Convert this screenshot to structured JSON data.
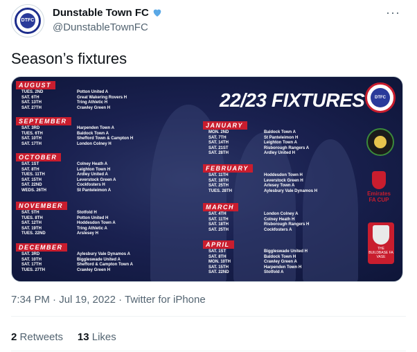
{
  "account": {
    "name": "Dunstable Town FC",
    "handle": "@DunstableTownFC",
    "avatar_text": "DTFC",
    "verified_icon": "heart-icon",
    "verified_color": "#5aa8e6"
  },
  "more_label": "···",
  "tweet": {
    "text": "Season’s fixtures",
    "timestamp": "7:34 PM · Jul 19, 2022 · Twitter for iPhone",
    "retweets": "2",
    "retweets_label": "Retweets",
    "likes": "13",
    "likes_label": "Likes"
  },
  "image": {
    "title": "22/23 FIXTURES",
    "crest_text": "DTFC",
    "facup_label": "Emirates FA CUP",
    "favase_label": "THE BUILDBASE FA VASE",
    "accent": "#c91d2e",
    "months": [
      {
        "name": "AUGUST",
        "fixtures": [
          {
            "date": "TUES. 2ND",
            "opp": "Potton United A"
          },
          {
            "date": "SAT. 6TH",
            "opp": "Great Wakering Rovers H"
          },
          {
            "date": "SAT. 13TH",
            "opp": "Tring Athletic H"
          },
          {
            "date": "SAT. 27TH",
            "opp": "Crawley Green H"
          }
        ]
      },
      {
        "name": "SEPTEMBER",
        "fixtures": [
          {
            "date": "SAT. 3RD",
            "opp": "Harpenden Town A"
          },
          {
            "date": "TUES. 6TH",
            "opp": "Baldock Town A"
          },
          {
            "date": "SAT. 10TH",
            "opp": "Shefford Town & Campton H"
          },
          {
            "date": "SAT. 17TH",
            "opp": "London Colney H"
          }
        ]
      },
      {
        "name": "OCTOBER",
        "fixtures": [
          {
            "date": "SAT. 1ST",
            "opp": "Colney Heath A"
          },
          {
            "date": "SAT. 8TH",
            "opp": "Leighton Town H"
          },
          {
            "date": "TUES. 11TH",
            "opp": "Ardley United A"
          },
          {
            "date": "SAT. 15TH",
            "opp": "Leverstock Green A"
          },
          {
            "date": "SAT. 22ND",
            "opp": "Cockfosters H"
          },
          {
            "date": "WEDS. 26TH",
            "opp": "St Panteleimon A"
          }
        ]
      },
      {
        "name": "NOVEMBER",
        "fixtures": [
          {
            "date": "SAT. 5TH",
            "opp": "Stotfold H"
          },
          {
            "date": "TUES. 8TH",
            "opp": "Potton United H"
          },
          {
            "date": "SAT. 12TH",
            "opp": "Hoddesdon Town A"
          },
          {
            "date": "SAT. 19TH",
            "opp": "Tring Athletic A"
          },
          {
            "date": "TUES. 22ND",
            "opp": "Arslesey H"
          }
        ]
      },
      {
        "name": "DECEMBER",
        "fixtures": [
          {
            "date": "SAT. 3RD",
            "opp": "Aylesbury Vale Dynamos A"
          },
          {
            "date": "SAT. 10TH",
            "opp": "Biggleswade United A"
          },
          {
            "date": "SAT. 17TH",
            "opp": "Shefford & Campton Town A"
          },
          {
            "date": "TUES. 27TH",
            "opp": "Crawley Green H"
          }
        ]
      },
      {
        "name": "JANUARY",
        "fixtures": [
          {
            "date": "MON. 2ND",
            "opp": "Baldock Town A"
          },
          {
            "date": "SAT. 7TH",
            "opp": "St Panteleimon H"
          },
          {
            "date": "SAT. 14TH",
            "opp": "Leighton Town A"
          },
          {
            "date": "SAT. 21ST",
            "opp": "Risborough Rangers A"
          },
          {
            "date": "SAT. 28TH",
            "opp": "Ardley United H"
          }
        ]
      },
      {
        "name": "FEBRUARY",
        "fixtures": [
          {
            "date": "SAT. 11TH",
            "opp": "Hoddesdon Town H"
          },
          {
            "date": "SAT. 18TH",
            "opp": "Leverstock Green H"
          },
          {
            "date": "SAT. 25TH",
            "opp": "Arlesey Town A"
          },
          {
            "date": "TUES. 28TH",
            "opp": "Aylesbury Vale Dynamos H"
          }
        ]
      },
      {
        "name": "MARCH",
        "fixtures": [
          {
            "date": "SAT. 4TH",
            "opp": "London Colney A"
          },
          {
            "date": "SAT. 11TH",
            "opp": "Colney Heath H"
          },
          {
            "date": "SAT. 18TH",
            "opp": "Risborough Rangers H"
          },
          {
            "date": "SAT. 25TH",
            "opp": "Cockfosters A"
          }
        ]
      },
      {
        "name": "APRIL",
        "fixtures": [
          {
            "date": "SAT. 1ST",
            "opp": "Biggleswade United H"
          },
          {
            "date": "SAT. 8TH",
            "opp": "Baldock Town H"
          },
          {
            "date": "MON. 10TH",
            "opp": "Crawley Green A"
          },
          {
            "date": "SAT. 15TH",
            "opp": "Harpenden Town H"
          },
          {
            "date": "SAT. 22ND",
            "opp": "Stotfold A"
          }
        ]
      }
    ]
  }
}
